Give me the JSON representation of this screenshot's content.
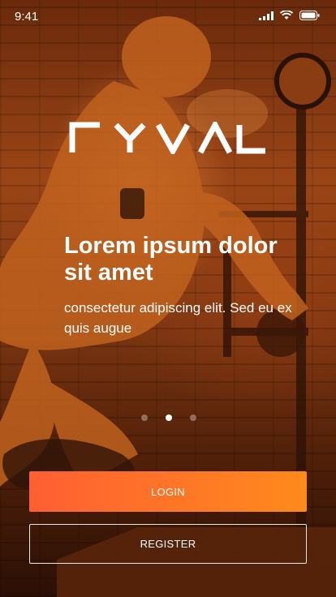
{
  "status_bar": {
    "time": "9:41",
    "icons": [
      "signal-icon",
      "wifi-icon",
      "battery-icon"
    ]
  },
  "brand": {
    "logo_text": "RYVAL",
    "accent_color": "#FF6A2B"
  },
  "hero": {
    "headline": "Lorem ipsum dolor sit amet",
    "subtitle": "consectetur adipiscing elit. Sed eu ex quis augue"
  },
  "carousel": {
    "total_pages": 3,
    "active_page": 2
  },
  "actions": {
    "login_label": "LOGIN",
    "register_label": "REGISTER"
  }
}
